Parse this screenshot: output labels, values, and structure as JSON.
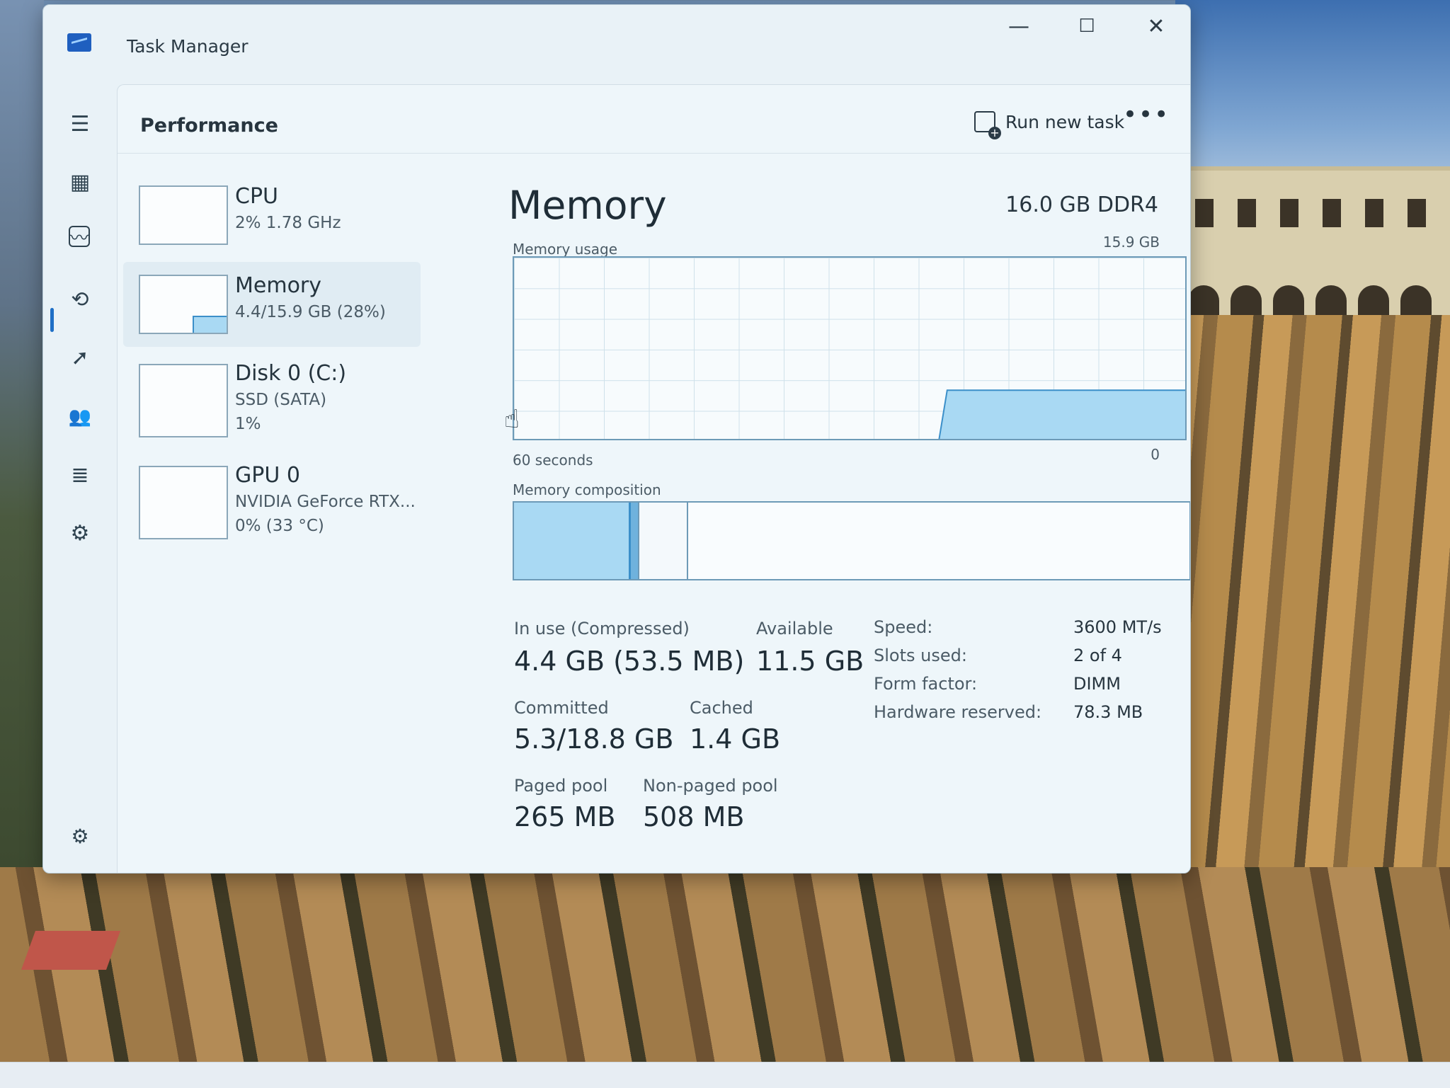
{
  "window": {
    "title": "Task Manager"
  },
  "caption": {
    "minimize": "—",
    "maximize": "☐",
    "close": "✕"
  },
  "sidebar": {
    "icons": [
      "hamburger-icon",
      "processes-icon",
      "performance-icon",
      "app-history-icon",
      "startup-apps-icon",
      "users-icon",
      "details-icon",
      "services-icon",
      "settings-icon"
    ],
    "glyphs": {
      "hamburger": "☰",
      "processes": "▦",
      "performance": "〰",
      "history": "⟲",
      "startup": "➚",
      "users": "👥",
      "details": "≣",
      "services": "⚙",
      "settings": "⚙"
    }
  },
  "header": {
    "page_title": "Performance",
    "run_new_task": "Run new task",
    "more": "•••"
  },
  "resources": [
    {
      "name": "CPU",
      "line1": "2% 1.78 GHz",
      "line2": ""
    },
    {
      "name": "Memory",
      "line1": "4.4/15.9 GB (28%)",
      "line2": ""
    },
    {
      "name": "Disk 0 (C:)",
      "line1": "SSD (SATA)",
      "line2": "1%"
    },
    {
      "name": "GPU 0",
      "line1": "NVIDIA GeForce RTX...",
      "line2": "0% (33 °C)"
    }
  ],
  "memory_thumb_fill": 0.28,
  "detail": {
    "title": "Memory",
    "type": "16.0 GB DDR4",
    "usage_label": "Memory usage",
    "usage_max": "15.9 GB",
    "time_left": "60 seconds",
    "time_right": "0",
    "composition_label": "Memory composition",
    "usage_fraction": 0.28,
    "composition": {
      "in_use_gb": 4.4,
      "modified_gb": 0.1,
      "standby_gb": 1.4,
      "total_gb": 15.9
    }
  },
  "stats": {
    "in_use_label": "In use (Compressed)",
    "in_use_value": "4.4 GB (53.5 MB)",
    "available_label": "Available",
    "available_value": "11.5 GB",
    "committed_label": "Committed",
    "committed_value": "5.3/18.8 GB",
    "cached_label": "Cached",
    "cached_value": "1.4 GB",
    "paged_pool_label": "Paged pool",
    "paged_pool_value": "265 MB",
    "nonpaged_pool_label": "Non-paged pool",
    "nonpaged_pool_value": "508 MB"
  },
  "specs": {
    "speed_label": "Speed:",
    "speed_value": "3600 MT/s",
    "slots_label": "Slots used:",
    "slots_value": "2 of 4",
    "form_label": "Form factor:",
    "form_value": "DIMM",
    "hw_reserved_label": "Hardware reserved:",
    "hw_reserved_value": "78.3 MB"
  },
  "colors": {
    "accent": "#1e6fc6",
    "graph_fill": "#a9d9f3",
    "graph_line": "#3b8fc9"
  }
}
